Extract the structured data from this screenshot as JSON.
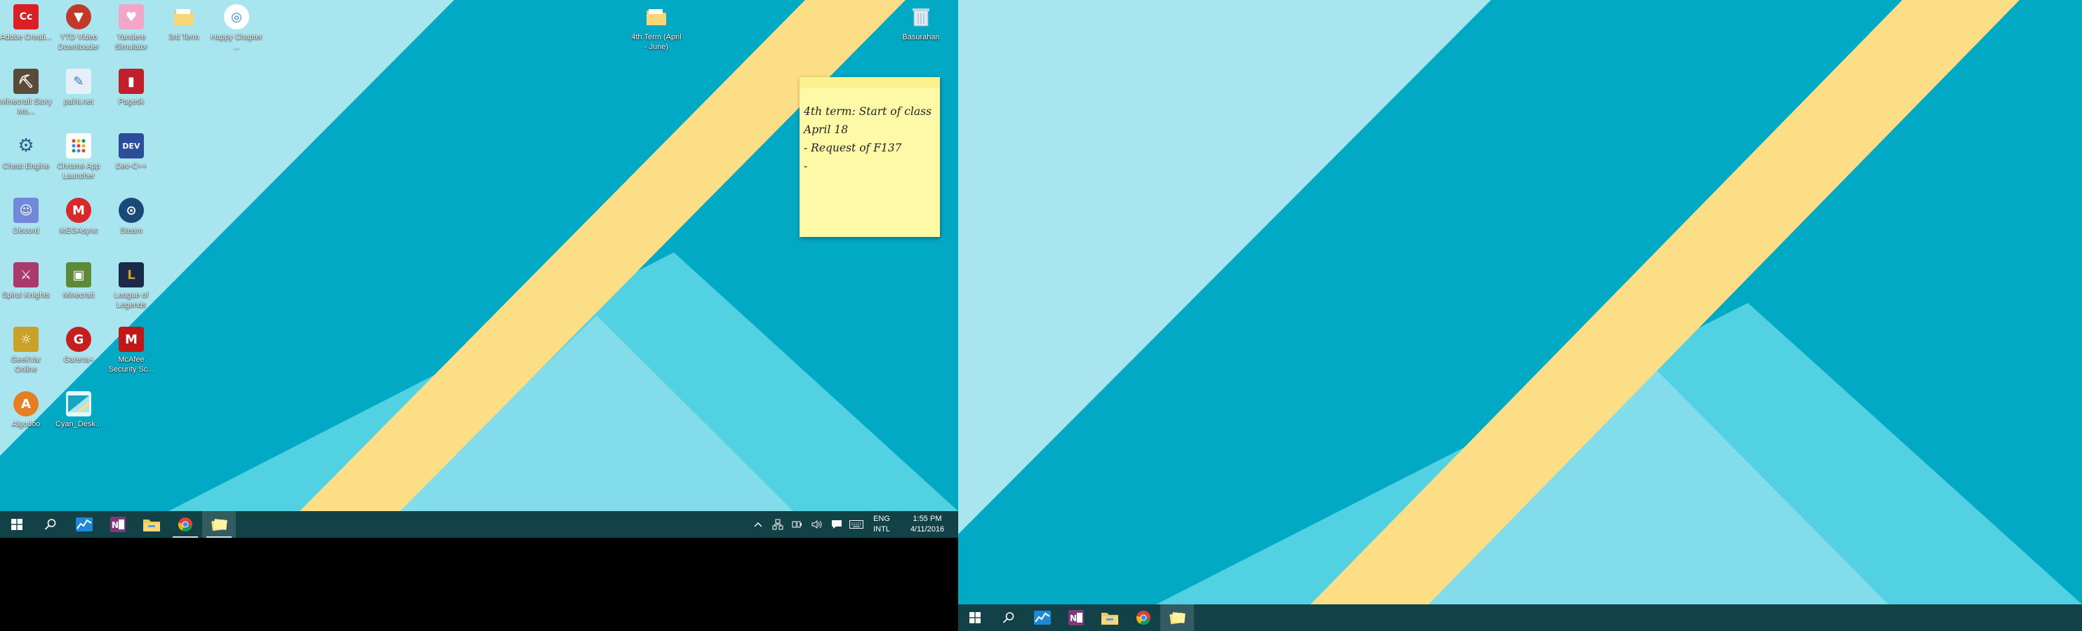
{
  "screen": {
    "monitors": 2
  },
  "wallpaper": {
    "colors": {
      "main": "#02a9c5",
      "light": "#a9e5ef",
      "stripe": "#fcde86",
      "triangle_outer": "#52d1e3",
      "triangle_inner": "#83dcea"
    }
  },
  "desktop_icons": [
    {
      "label": "Adobe Creati...",
      "icon": "adobe-creative-cloud-icon",
      "color": "#da1f26",
      "glyph": "Cc"
    },
    {
      "label": "YTD Video Downloader",
      "icon": "ytd-video-downloader-icon",
      "color": "#c0392b",
      "glyph": "▼"
    },
    {
      "label": "Yandere Simulator",
      "icon": "yandere-simulator-icon",
      "color": "#f3a6c8",
      "glyph": "♥"
    },
    {
      "label": "3rd Term",
      "icon": "folder-icon",
      "color": "#f0c75e",
      "glyph": ""
    },
    {
      "label": "Happy Chapter ...",
      "icon": "happy-chapter-icon",
      "color": "#2d7fd3",
      "glyph": "◎"
    },
    {
      "label": "Minecraft Story Mo...",
      "icon": "minecraft-story-mode-icon",
      "color": "#5a4a3a",
      "glyph": "⛏"
    },
    {
      "label": "paint.net",
      "icon": "paint-net-icon",
      "color": "#3a6fc4",
      "glyph": "✎"
    },
    {
      "label": "Pagesk",
      "icon": "pagesk-icon",
      "color": "#c0202a",
      "glyph": "▮"
    },
    {
      "label": "Cheat Engine",
      "icon": "cheat-engine-icon",
      "color": "#2a5c8a",
      "glyph": "⚙"
    },
    {
      "label": "Chrome App Launcher",
      "icon": "chrome-app-launcher-icon",
      "color": "#ffffff",
      "glyph": "⋮⋮"
    },
    {
      "label": "Dev-C++",
      "icon": "dev-cpp-icon",
      "color": "#2b4d9c",
      "glyph": "DEV"
    },
    {
      "label": "Discord",
      "icon": "discord-icon",
      "color": "#7289da",
      "glyph": "☺"
    },
    {
      "label": "MEGAsync",
      "icon": "megasync-icon",
      "color": "#d9272e",
      "glyph": "M"
    },
    {
      "label": "Steam",
      "icon": "steam-icon",
      "color": "#1b4a7a",
      "glyph": "⊙"
    },
    {
      "label": "Spiral Knights",
      "icon": "spiral-knights-icon",
      "color": "#a83a6c",
      "glyph": "⚔"
    },
    {
      "label": "Minecraft",
      "icon": "minecraft-icon",
      "color": "#5c8a3a",
      "glyph": "▣"
    },
    {
      "label": "League of Legends",
      "icon": "league-of-legends-icon",
      "color": "#1c2a4a",
      "glyph": "L"
    },
    {
      "label": "GeekVar Online",
      "icon": "geekvar-online-icon",
      "color": "#c9a227",
      "glyph": "☼"
    },
    {
      "label": "Garena+",
      "icon": "garena-plus-icon",
      "color": "#c41e1e",
      "glyph": "G"
    },
    {
      "label": "McAfee Security Sc...",
      "icon": "mcafee-security-icon",
      "color": "#c01818",
      "glyph": "M"
    },
    {
      "label": "Algodoo",
      "icon": "algodoo-icon",
      "color": "#e67e22",
      "glyph": "A"
    },
    {
      "label": "Cyan_Desk...",
      "icon": "cyan-desktop-image-icon",
      "color": "#1aa3c2",
      "glyph": "◢"
    },
    {
      "label": "4th Term (April - June)",
      "icon": "folder-icon",
      "color": "#f0c75e",
      "glyph": ""
    },
    {
      "label": "Basurahan",
      "icon": "recycle-bin-icon",
      "color": "#cfe6f2",
      "glyph": "🗑"
    }
  ],
  "sticky_note": {
    "lines": [
      "4th term: Start of class",
      "April 18",
      "",
      "- Request of F137",
      "-"
    ]
  },
  "taskbar": {
    "apps": [
      {
        "name": "start-button",
        "icon": "windows-logo-icon"
      },
      {
        "name": "search-button",
        "icon": "search-icon"
      },
      {
        "name": "taskbar-app-stocks",
        "icon": "stocks-chart-icon"
      },
      {
        "name": "taskbar-app-onenote",
        "icon": "onenote-icon"
      },
      {
        "name": "taskbar-app-file-explorer",
        "icon": "file-explorer-icon"
      },
      {
        "name": "taskbar-app-chrome",
        "icon": "chrome-icon"
      },
      {
        "name": "taskbar-app-sticky-notes",
        "icon": "sticky-notes-icon"
      }
    ],
    "tray": {
      "lang_line1": "ENG",
      "lang_line2": "INTL",
      "time": "1:55 PM",
      "date": "4/11/2016"
    }
  }
}
